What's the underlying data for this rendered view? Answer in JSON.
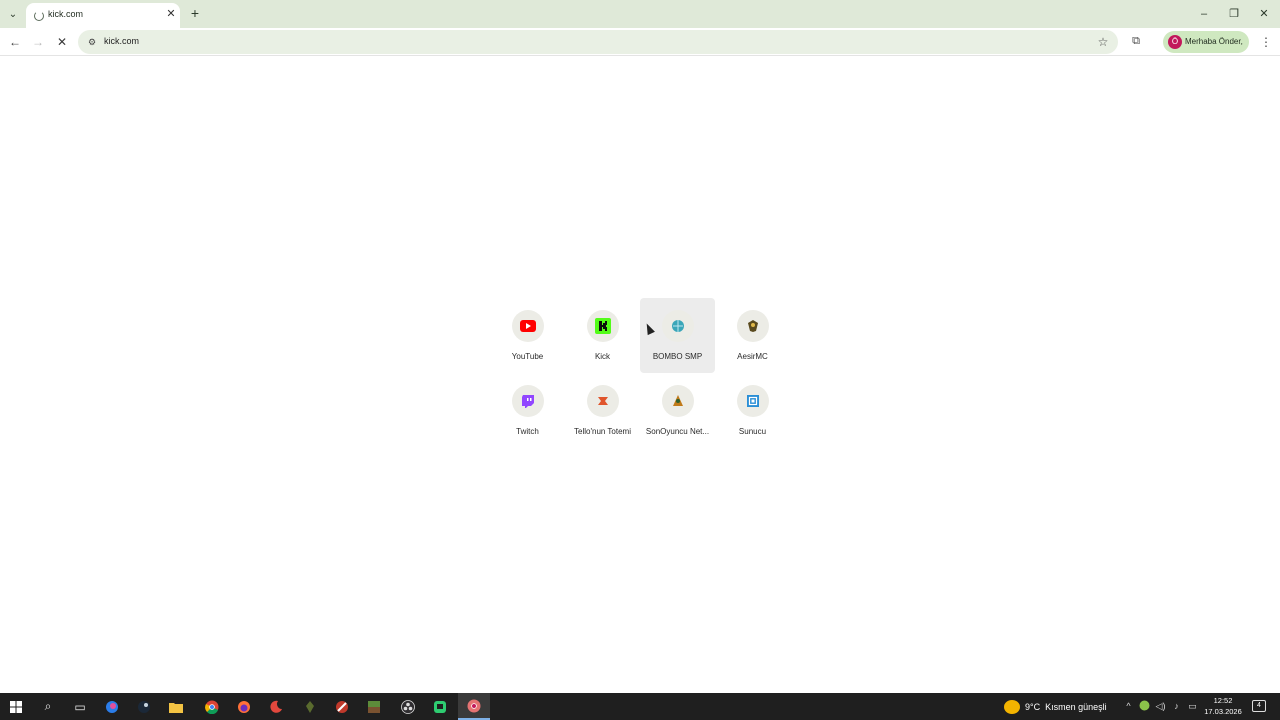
{
  "browser": {
    "tab": {
      "title": "kick.com"
    },
    "address_bar": {
      "url": "kick.com"
    },
    "profile": {
      "avatar_letter": "Ö",
      "label": "Merhaba Önder,"
    }
  },
  "shortcuts": [
    {
      "label": "YouTube",
      "icon": "youtube-icon",
      "color": "#ff0000"
    },
    {
      "label": "Kick",
      "icon": "kick-icon",
      "color": "#53fc18"
    },
    {
      "label": "BOMBO SMP",
      "icon": "globe-icon",
      "color": "#3aa6b9",
      "hovered": true
    },
    {
      "label": "AesirMC",
      "icon": "crest-icon",
      "color": "#5a4a1e"
    },
    {
      "label": "Twitch",
      "icon": "twitch-icon",
      "color": "#9146ff"
    },
    {
      "label": "Tello'nun Totemi",
      "icon": "totem-icon",
      "color": "#e0552c"
    },
    {
      "label": "SonOyuncu Net...",
      "icon": "sonoyuncu-icon",
      "color": "#c07a1a"
    },
    {
      "label": "Sunucu",
      "icon": "server-icon",
      "color": "#2b8fd6"
    }
  ],
  "taskbar": {
    "weather": {
      "temp": "9°C",
      "desc": "Kısmen güneşli"
    },
    "clock": {
      "time": "12:52",
      "date": "17.03.2026"
    },
    "notifications": "4"
  }
}
